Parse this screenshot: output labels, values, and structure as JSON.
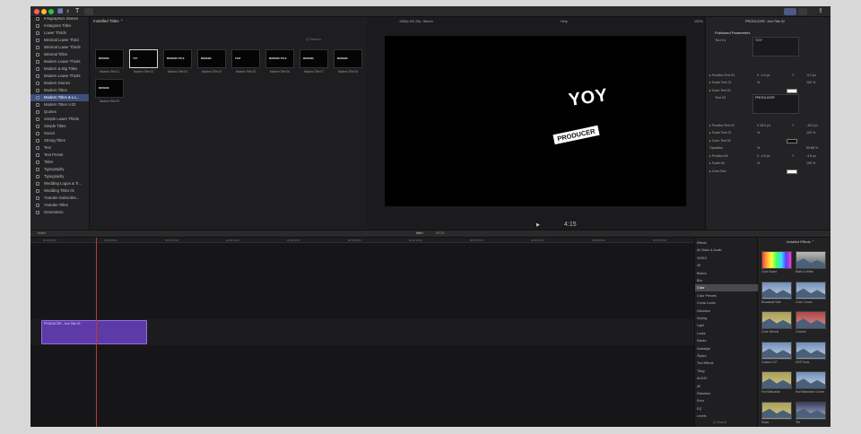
{
  "colors": {
    "accent": "#3d4f7c",
    "clip": "#5e3aa8",
    "playhead": "#c0392b",
    "red": "#ff5f57",
    "yellow": "#febc2e",
    "green": "#28c840"
  },
  "browser": {
    "title": "Installed Titles ⌃",
    "search_placeholder": "Q Search",
    "thumbs": [
      {
        "label": "Modern Title 01",
        "text": "MODERN"
      },
      {
        "label": "Modern Title 02",
        "text": "YOY"
      },
      {
        "label": "Modern Title 03",
        "text": "MODERN TITLE"
      },
      {
        "label": "Modern Title 04",
        "text": "MODERN"
      },
      {
        "label": "Modern Title 05",
        "text": "TEXT"
      },
      {
        "label": "Modern Title 06",
        "text": "MODERN TITLE"
      },
      {
        "label": "Modern Title 07",
        "text": "MODERN"
      },
      {
        "label": "Modern Title 08",
        "text": "MODERN"
      },
      {
        "label": "Modern Title 09",
        "text": "MODERN"
      }
    ]
  },
  "sidebar": {
    "items": [
      "Infographics Stories",
      "Instagram Titles",
      "Lower Thirds",
      "Minimal Lower Third",
      "Minimal Lower Thirds",
      "Minimal Titles",
      "Modern Lower Thirds",
      "Modern & Big Titles",
      "Modern Lower Thirds",
      "Modern Stories",
      "Modern Titles",
      "Modern Titles & Lo...",
      "Modern Titles V.02",
      "Quotes",
      "Simple Lower Thirds",
      "Simple Titles",
      "Social",
      "Strong Titles",
      "Text",
      "Text Preset",
      "Titles",
      "Typography",
      "Typography",
      "Wedding Logos & Ti...",
      "Wedding Titles 01",
      "Youtube Subscribe...",
      "Youtube Titles",
      "Generators"
    ]
  },
  "viewer": {
    "header_left": "1080p HD 25p, Stereo",
    "header_center": "Help",
    "zoom": "100%",
    "view": "View",
    "title_main": "YOY",
    "title_sub": "PRODUCER",
    "timecode": "4:15"
  },
  "inspector": {
    "header": "PRODUCER: Join Title 02",
    "section": "Published Parameters",
    "text1_label": "Text 01",
    "text1_value": "YOY",
    "text2_label": "Text 02",
    "text2_value": "PRODUCER",
    "rows": [
      {
        "k": "▸ Position Text 01",
        "v1": "X  -4.3 px",
        "v2": "Y",
        "v3": "-0.2 px"
      },
      {
        "k": "▸ Scale Text 01",
        "v1": "%",
        "v2": "",
        "v3": "100 %"
      },
      {
        "k": "▸ Color Text 01",
        "v1": "",
        "v2": "",
        "v3": ""
      },
      {
        "k": "▸ Position Text 02",
        "v1": "X  28.5 px",
        "v2": "Y",
        "v3": "-15.0 px"
      },
      {
        "k": "▸ Scale Text 02",
        "v1": "%",
        "v2": "",
        "v3": "100 %"
      },
      {
        "k": "▸ Color Text 02",
        "v1": "",
        "v2": "",
        "v3": ""
      },
      {
        "k": "   Opacities",
        "v1": "%",
        "v2": "",
        "v3": "59.88 %"
      },
      {
        "k": "▸ Position All",
        "v1": "X  -4.5 px",
        "v2": "Y",
        "v3": "-4.5 px"
      },
      {
        "k": "▸ Scale All",
        "v1": "%",
        "v2": "",
        "v3": "100 %"
      },
      {
        "k": "▸ Color Box",
        "v1": "",
        "v2": "",
        "v3": ""
      }
    ]
  },
  "timeline": {
    "index": "Index",
    "project": "Intro",
    "duration": "00:25",
    "ticks": [
      "00:00:00:00",
      "00:00:05:00",
      "00:00:10:00",
      "00:00:15:00",
      "00:00:20:00",
      "00:00:25:00",
      "00:00:30:00",
      "00:00:35:00",
      "00:00:40:00",
      "00:00:45:00",
      "00:00:50:00"
    ],
    "clip_label": "PRODUCER - Join Title 02"
  },
  "effects": {
    "header": "Installed Effects ⌃",
    "list": [
      "Effects",
      "All Video & Audio",
      "VIDEO",
      "4K",
      "Basics",
      "Blur",
      "Color",
      "Color Presets",
      "Comic Looks",
      "Distortion",
      "Keying",
      "Light",
      "Looks",
      "Masks",
      "Nostalgia",
      "Stylize",
      "Text Effects",
      "Tiling",
      "AUDIO",
      "All",
      "Distortion",
      "Echo",
      "EQ",
      "Levels"
    ],
    "thumbs": [
      {
        "label": "Color Board",
        "kind": "rainbow"
      },
      {
        "label": "Black & White",
        "kind": "bw"
      },
      {
        "label": "Broadcast Safe",
        "kind": "mtn"
      },
      {
        "label": "Color Curves",
        "kind": "mtn"
      },
      {
        "label": "Color Wheels",
        "kind": "warm"
      },
      {
        "label": "Colorize",
        "kind": "red"
      },
      {
        "label": "Custom LUT",
        "kind": "mtn"
      },
      {
        "label": "HDR Tools",
        "kind": "mtn"
      },
      {
        "label": "Hue/Saturation",
        "kind": "warm"
      },
      {
        "label": "Hue/Saturation Curves",
        "kind": "mtn"
      },
      {
        "label": "Sepia",
        "kind": "warm"
      },
      {
        "label": "Tint",
        "kind": "dusk"
      }
    ],
    "search_placeholder": "Q Search"
  }
}
